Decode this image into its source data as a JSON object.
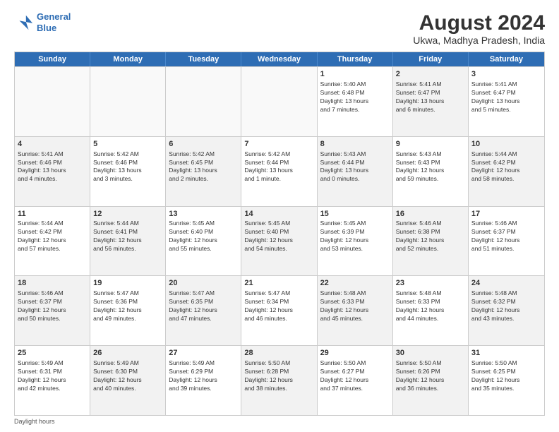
{
  "logo": {
    "line1": "General",
    "line2": "Blue"
  },
  "title": "August 2024",
  "subtitle": "Ukwa, Madhya Pradesh, India",
  "days": [
    "Sunday",
    "Monday",
    "Tuesday",
    "Wednesday",
    "Thursday",
    "Friday",
    "Saturday"
  ],
  "footer": "Daylight hours",
  "weeks": [
    [
      {
        "num": "",
        "text": "",
        "shaded": false,
        "empty": true
      },
      {
        "num": "",
        "text": "",
        "shaded": false,
        "empty": true
      },
      {
        "num": "",
        "text": "",
        "shaded": false,
        "empty": true
      },
      {
        "num": "",
        "text": "",
        "shaded": false,
        "empty": true
      },
      {
        "num": "1",
        "text": "Sunrise: 5:40 AM\nSunset: 6:48 PM\nDaylight: 13 hours\nand 7 minutes.",
        "shaded": false,
        "empty": false
      },
      {
        "num": "2",
        "text": "Sunrise: 5:41 AM\nSunset: 6:47 PM\nDaylight: 13 hours\nand 6 minutes.",
        "shaded": true,
        "empty": false
      },
      {
        "num": "3",
        "text": "Sunrise: 5:41 AM\nSunset: 6:47 PM\nDaylight: 13 hours\nand 5 minutes.",
        "shaded": false,
        "empty": false
      }
    ],
    [
      {
        "num": "4",
        "text": "Sunrise: 5:41 AM\nSunset: 6:46 PM\nDaylight: 13 hours\nand 4 minutes.",
        "shaded": true,
        "empty": false
      },
      {
        "num": "5",
        "text": "Sunrise: 5:42 AM\nSunset: 6:46 PM\nDaylight: 13 hours\nand 3 minutes.",
        "shaded": false,
        "empty": false
      },
      {
        "num": "6",
        "text": "Sunrise: 5:42 AM\nSunset: 6:45 PM\nDaylight: 13 hours\nand 2 minutes.",
        "shaded": true,
        "empty": false
      },
      {
        "num": "7",
        "text": "Sunrise: 5:42 AM\nSunset: 6:44 PM\nDaylight: 13 hours\nand 1 minute.",
        "shaded": false,
        "empty": false
      },
      {
        "num": "8",
        "text": "Sunrise: 5:43 AM\nSunset: 6:44 PM\nDaylight: 13 hours\nand 0 minutes.",
        "shaded": true,
        "empty": false
      },
      {
        "num": "9",
        "text": "Sunrise: 5:43 AM\nSunset: 6:43 PM\nDaylight: 12 hours\nand 59 minutes.",
        "shaded": false,
        "empty": false
      },
      {
        "num": "10",
        "text": "Sunrise: 5:44 AM\nSunset: 6:42 PM\nDaylight: 12 hours\nand 58 minutes.",
        "shaded": true,
        "empty": false
      }
    ],
    [
      {
        "num": "11",
        "text": "Sunrise: 5:44 AM\nSunset: 6:42 PM\nDaylight: 12 hours\nand 57 minutes.",
        "shaded": false,
        "empty": false
      },
      {
        "num": "12",
        "text": "Sunrise: 5:44 AM\nSunset: 6:41 PM\nDaylight: 12 hours\nand 56 minutes.",
        "shaded": true,
        "empty": false
      },
      {
        "num": "13",
        "text": "Sunrise: 5:45 AM\nSunset: 6:40 PM\nDaylight: 12 hours\nand 55 minutes.",
        "shaded": false,
        "empty": false
      },
      {
        "num": "14",
        "text": "Sunrise: 5:45 AM\nSunset: 6:40 PM\nDaylight: 12 hours\nand 54 minutes.",
        "shaded": true,
        "empty": false
      },
      {
        "num": "15",
        "text": "Sunrise: 5:45 AM\nSunset: 6:39 PM\nDaylight: 12 hours\nand 53 minutes.",
        "shaded": false,
        "empty": false
      },
      {
        "num": "16",
        "text": "Sunrise: 5:46 AM\nSunset: 6:38 PM\nDaylight: 12 hours\nand 52 minutes.",
        "shaded": true,
        "empty": false
      },
      {
        "num": "17",
        "text": "Sunrise: 5:46 AM\nSunset: 6:37 PM\nDaylight: 12 hours\nand 51 minutes.",
        "shaded": false,
        "empty": false
      }
    ],
    [
      {
        "num": "18",
        "text": "Sunrise: 5:46 AM\nSunset: 6:37 PM\nDaylight: 12 hours\nand 50 minutes.",
        "shaded": true,
        "empty": false
      },
      {
        "num": "19",
        "text": "Sunrise: 5:47 AM\nSunset: 6:36 PM\nDaylight: 12 hours\nand 49 minutes.",
        "shaded": false,
        "empty": false
      },
      {
        "num": "20",
        "text": "Sunrise: 5:47 AM\nSunset: 6:35 PM\nDaylight: 12 hours\nand 47 minutes.",
        "shaded": true,
        "empty": false
      },
      {
        "num": "21",
        "text": "Sunrise: 5:47 AM\nSunset: 6:34 PM\nDaylight: 12 hours\nand 46 minutes.",
        "shaded": false,
        "empty": false
      },
      {
        "num": "22",
        "text": "Sunrise: 5:48 AM\nSunset: 6:33 PM\nDaylight: 12 hours\nand 45 minutes.",
        "shaded": true,
        "empty": false
      },
      {
        "num": "23",
        "text": "Sunrise: 5:48 AM\nSunset: 6:33 PM\nDaylight: 12 hours\nand 44 minutes.",
        "shaded": false,
        "empty": false
      },
      {
        "num": "24",
        "text": "Sunrise: 5:48 AM\nSunset: 6:32 PM\nDaylight: 12 hours\nand 43 minutes.",
        "shaded": true,
        "empty": false
      }
    ],
    [
      {
        "num": "25",
        "text": "Sunrise: 5:49 AM\nSunset: 6:31 PM\nDaylight: 12 hours\nand 42 minutes.",
        "shaded": false,
        "empty": false
      },
      {
        "num": "26",
        "text": "Sunrise: 5:49 AM\nSunset: 6:30 PM\nDaylight: 12 hours\nand 40 minutes.",
        "shaded": true,
        "empty": false
      },
      {
        "num": "27",
        "text": "Sunrise: 5:49 AM\nSunset: 6:29 PM\nDaylight: 12 hours\nand 39 minutes.",
        "shaded": false,
        "empty": false
      },
      {
        "num": "28",
        "text": "Sunrise: 5:50 AM\nSunset: 6:28 PM\nDaylight: 12 hours\nand 38 minutes.",
        "shaded": true,
        "empty": false
      },
      {
        "num": "29",
        "text": "Sunrise: 5:50 AM\nSunset: 6:27 PM\nDaylight: 12 hours\nand 37 minutes.",
        "shaded": false,
        "empty": false
      },
      {
        "num": "30",
        "text": "Sunrise: 5:50 AM\nSunset: 6:26 PM\nDaylight: 12 hours\nand 36 minutes.",
        "shaded": true,
        "empty": false
      },
      {
        "num": "31",
        "text": "Sunrise: 5:50 AM\nSunset: 6:25 PM\nDaylight: 12 hours\nand 35 minutes.",
        "shaded": false,
        "empty": false
      }
    ]
  ]
}
